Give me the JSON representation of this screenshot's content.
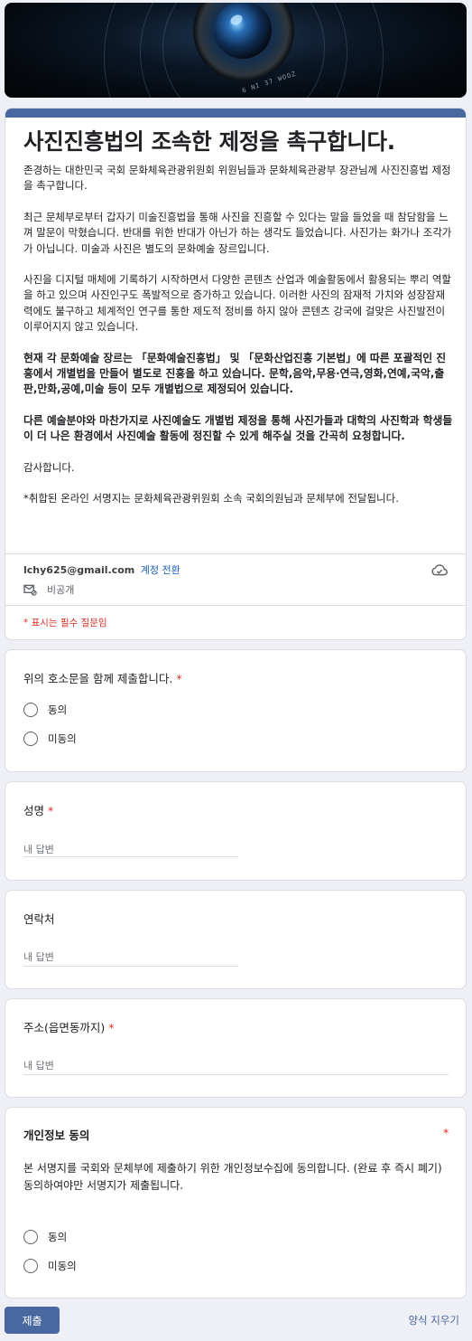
{
  "banner": {
    "lens_text": "6 NI 37 WOOZ"
  },
  "form": {
    "title": "사진진흥법의 조속한 제정을 촉구합니다.",
    "description": [
      {
        "text": "존경하는 대한민국 국회 문화체육관광위원회 위원님들과 문화체육관광부 장관님께 사진진흥법 제정을 촉구합니다.",
        "bold": false
      },
      {
        "text": "최근 문체부로부터 갑자기 미술진흥법을 통해 사진을 진흥할 수 있다는 말을 들었을 때 참담함을 느껴 말문이 막혔습니다. 반대를 위한 반대가 아닌가 하는 생각도 들었습니다. 사진가는 화가나 조각가가 아닙니다. 미술과 사진은 별도의 문화예술 장르입니다.",
        "bold": false
      },
      {
        "text": "사진을 디지털 매체에 기록하기 시작하면서 다양한 콘텐츠 산업과 예술활동에서 활용되는 뿌리 역할을 하고 있으며 사진인구도 폭발적으로 증가하고 있습니다. 이러한 사진의 잠재적 가치와 성장잠재력에도 불구하고 체계적인 연구를 통한 제도적 정비를 하지 않아 콘텐츠 강국에 걸맞은 사진발전이 이루어지지 않고 있습니다.",
        "bold": false
      },
      {
        "text": "현재 각 문화예술 장르는 「문화예술진흥법」 및 「문화산업진흥 기본법」에 따른 포괄적인 진흥에서 개별법을 만들어 별도로 진흥을 하고 있습니다. 문학,음악,무용·연극,영화,연예,국악,출판,만화,공예,미술 등이 모두 개별법으로 제정되어 있습니다.",
        "bold": true
      },
      {
        "text": "다른 예술분야와 마찬가지로 사진예술도 개별법 제정을 통해 사진가들과 대학의 사진학과 학생들이 더 나은 환경에서 사진예술 활동에 정진할 수 있게 해주실 것을 간곡히 요청합니다.",
        "bold": true
      },
      {
        "text": "감사합니다.",
        "bold": false
      },
      {
        "text": "*취합된 온라인 서명지는 문화체육관광위원회 소속 국회의원님과 문체부에 전달됩니다.",
        "bold": false
      }
    ],
    "account_email": "lchy625@gmail.com",
    "switch_account": "계정 전환",
    "private_label": "비공개",
    "required_note": "* 표시는 필수 질문임"
  },
  "questions": {
    "q1": {
      "title": "위의 호소문을 함께 제출합니다.",
      "required": "*",
      "options": [
        "동의",
        "미동의"
      ]
    },
    "q2": {
      "title": "성명",
      "required": "*",
      "placeholder": "내 답변"
    },
    "q3": {
      "title": "연락처",
      "placeholder": "내 답변"
    },
    "q4": {
      "title": "주소(읍면동까지)",
      "required": "*",
      "placeholder": "내 답변"
    },
    "q5": {
      "title": "개인정보 동의",
      "required": "*",
      "description_line1": "본 서명지를 국회와 문체부에 제출하기 위한 개인정보수집에 동의합니다. (완료 후 즉시 폐기)",
      "description_line2": "동의하여야만 서명지가 제출됩니다.",
      "options": [
        "동의",
        "미동의"
      ]
    }
  },
  "footer": {
    "submit_label": "제출",
    "clear_label": "양식 지우기"
  },
  "colors": {
    "accent": "#4a68a0",
    "required": "#d93025",
    "link": "#1a5fb4"
  }
}
